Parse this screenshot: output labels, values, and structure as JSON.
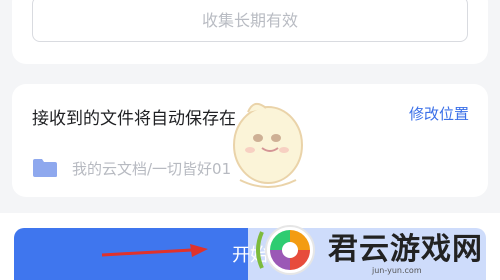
{
  "top_card": {
    "validity_text": "收集长期有效"
  },
  "save_card": {
    "title": "接收到的文件将自动保存在",
    "modify_link": "修改位置",
    "folder_path": "我的云文档/一切皆好01"
  },
  "bottom": {
    "start_label": "开始"
  },
  "watermark": {
    "name": "君云游戏网",
    "site": "jun-yun.com"
  },
  "colors": {
    "accent": "#3f76ee",
    "link": "#3a6fe8",
    "folder": "#8ea8ee",
    "arrow": "#e0322b"
  }
}
